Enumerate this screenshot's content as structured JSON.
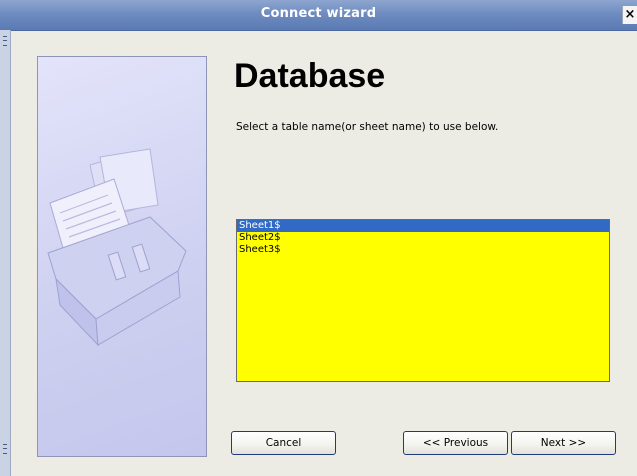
{
  "window": {
    "title": "Connect wizard",
    "close_label": "×"
  },
  "page": {
    "heading": "Database",
    "instruction": "Select a table name(or sheet name) to use below."
  },
  "table_list": {
    "selected_index": 0,
    "items": [
      "Sheet1$",
      "Sheet2$",
      "Sheet3$"
    ]
  },
  "buttons": {
    "cancel": "Cancel",
    "previous": "<< Previous",
    "next": "Next >>"
  },
  "colors": {
    "list_background": "#ffff00",
    "selection": "#316ac5",
    "titlebar": "#6e8cc0",
    "side_panel": "#cfd1f1"
  },
  "icons": {
    "side_panel_image": "card-file-index-illustration"
  }
}
